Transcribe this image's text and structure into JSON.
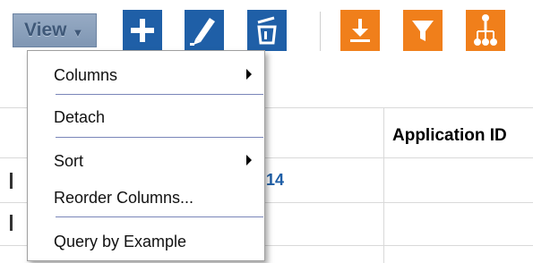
{
  "toolbar": {
    "view_label": "View",
    "buttons": [
      {
        "name": "add-button",
        "icon": "plus-icon"
      },
      {
        "name": "edit-button",
        "icon": "pencil-icon"
      },
      {
        "name": "delete-button",
        "icon": "trash-icon"
      },
      {
        "name": "export-button",
        "icon": "download-icon"
      },
      {
        "name": "filter-button",
        "icon": "funnel-icon"
      },
      {
        "name": "hierarchy-button",
        "icon": "hierarchy-icon"
      }
    ],
    "colors": {
      "blue": "#1f5fa7",
      "orange": "#f07f1b",
      "view_bg": "#8aa0bd"
    }
  },
  "view_menu": {
    "items": [
      {
        "label": "Columns",
        "has_submenu": true
      },
      {
        "label": "Detach",
        "has_submenu": false
      },
      {
        "label": "Sort",
        "has_submenu": true
      },
      {
        "label": "Reorder Columns...",
        "has_submenu": false
      },
      {
        "label": "Query by Example",
        "has_submenu": false
      }
    ]
  },
  "table": {
    "headers": [
      "Application ID"
    ],
    "visible_cell_fragment": "14"
  }
}
